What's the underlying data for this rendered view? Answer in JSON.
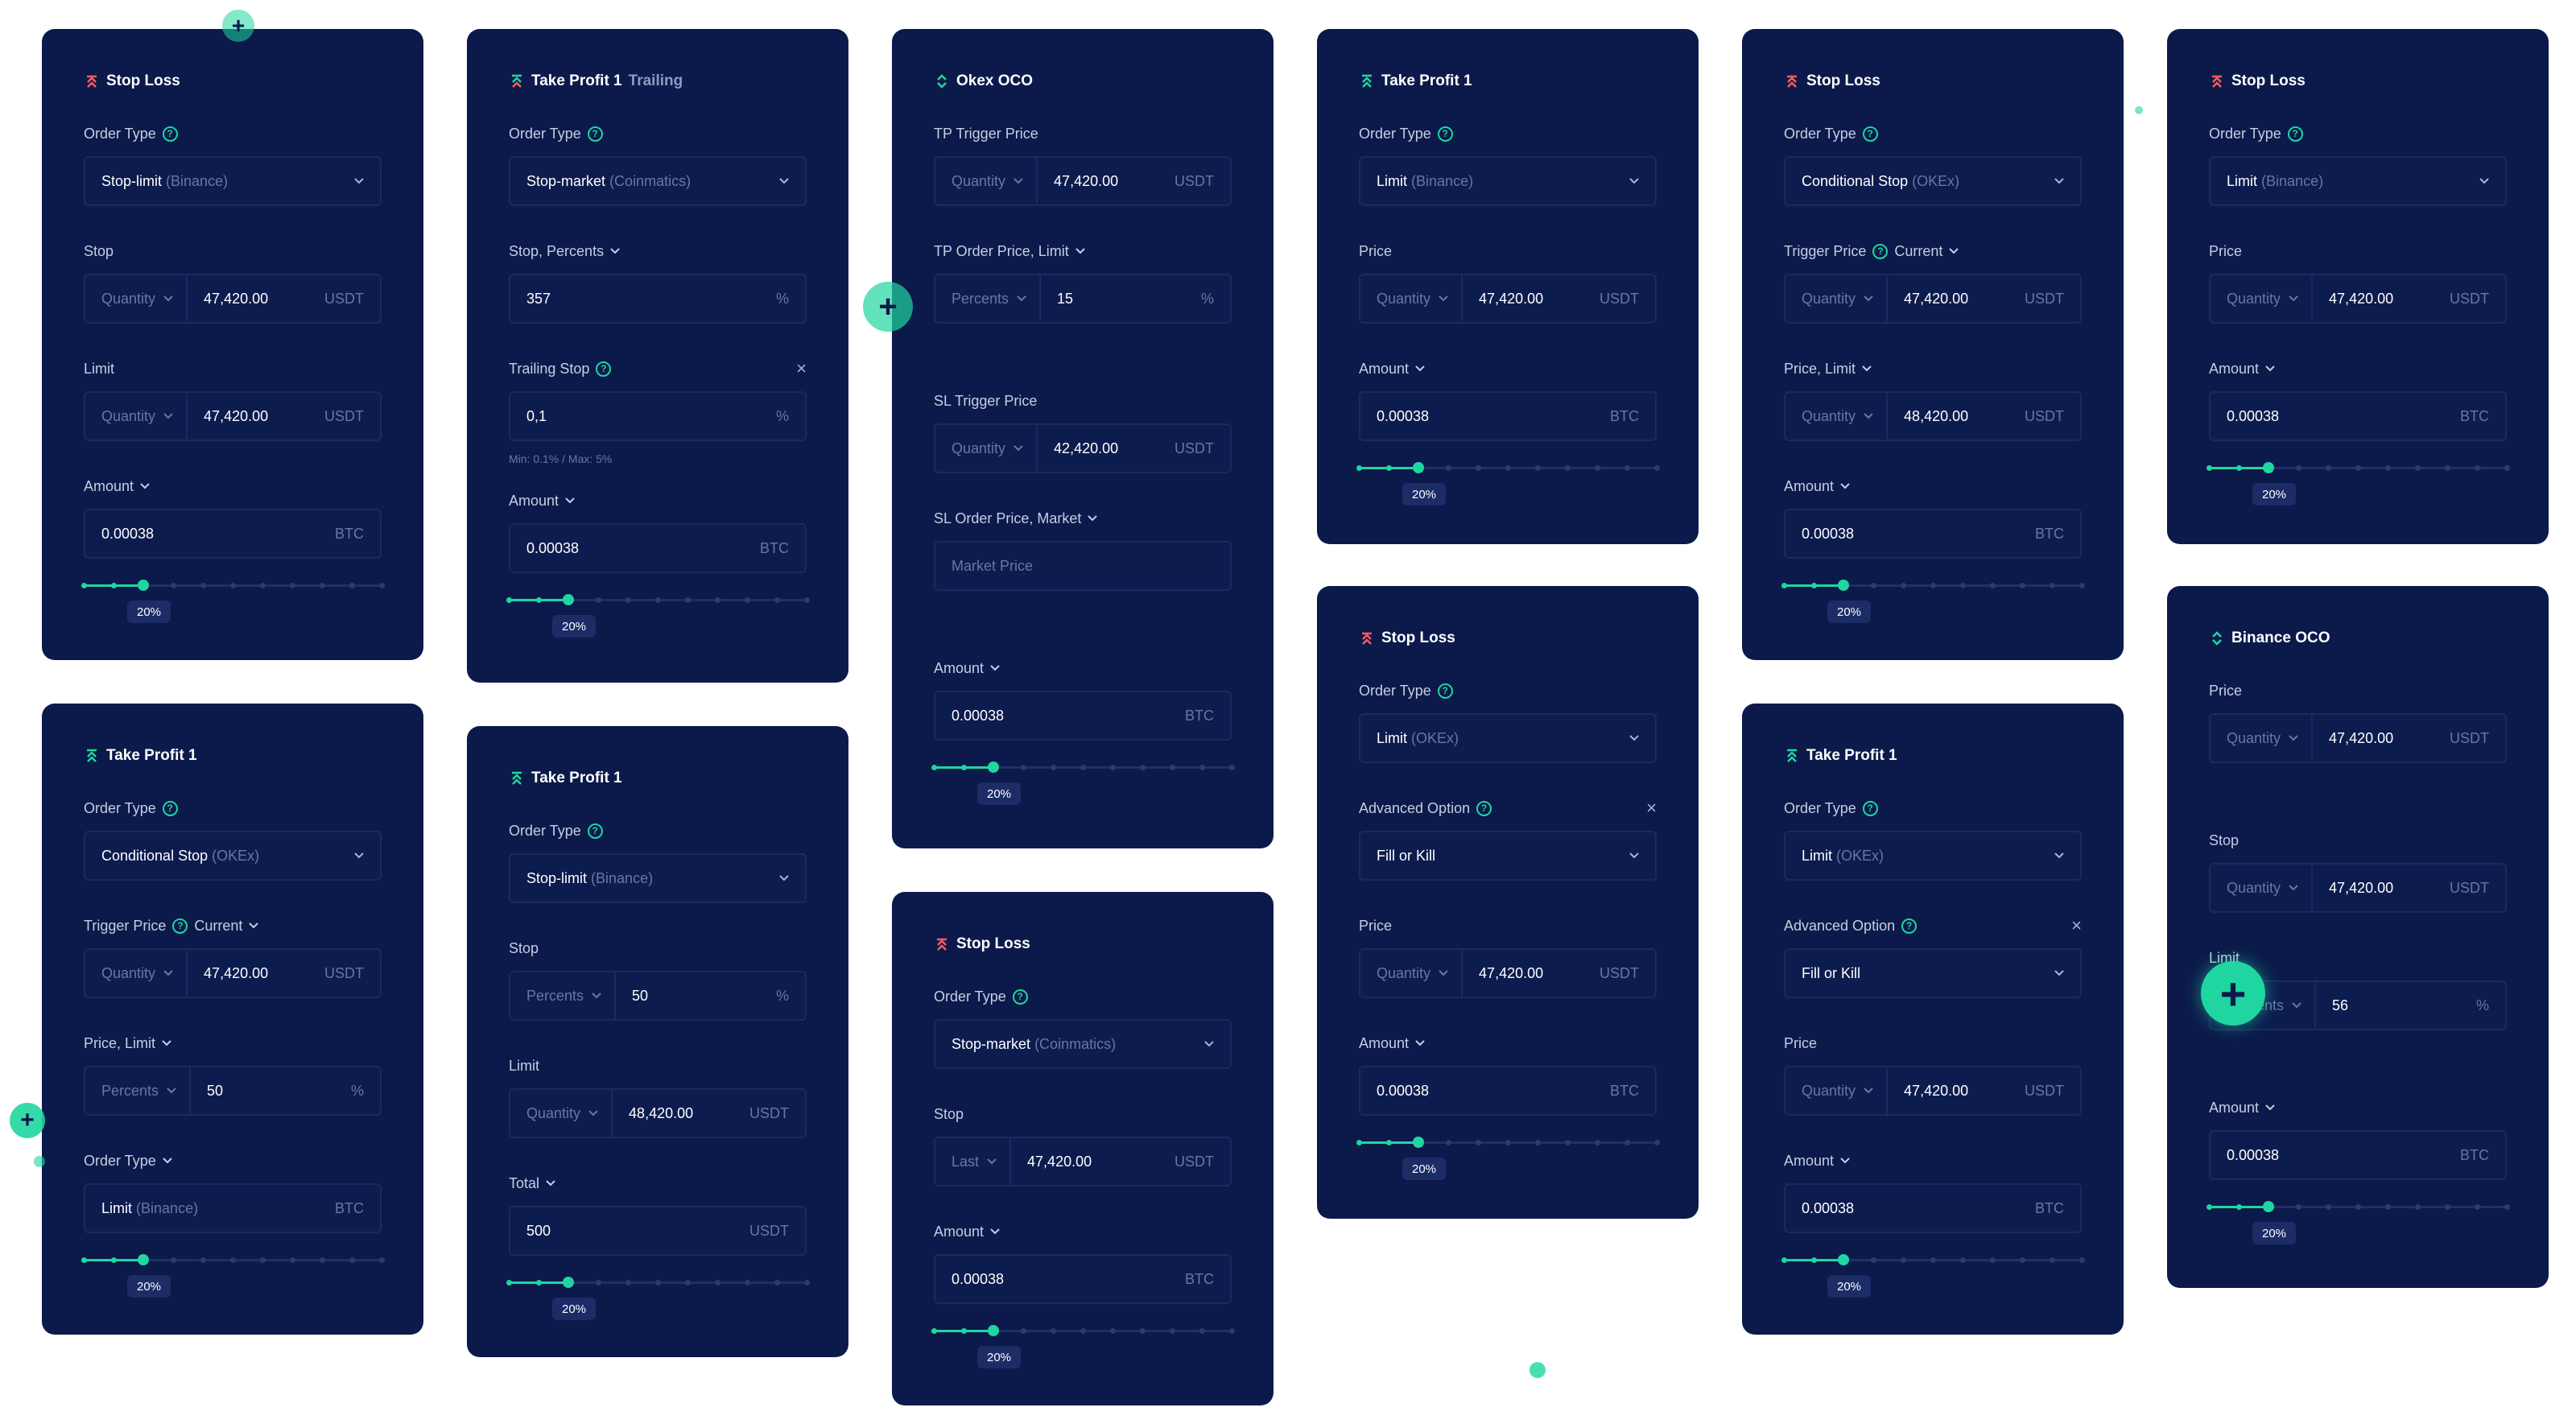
{
  "labels": {
    "order_type": "Order Type",
    "stop": "Stop",
    "limit": "Limit",
    "amount": "Amount",
    "price": "Price",
    "quantity": "Quantity",
    "percents": "Percents",
    "last": "Last",
    "usdt": "USDT",
    "btc": "BTC",
    "pct": "%",
    "current": "Current",
    "trigger_price": "Trigger Price",
    "price_limit": "Price, Limit",
    "advanced_option": "Advanced Option",
    "trailing_stop": "Trailing Stop",
    "stop_percents": "Stop, Percents",
    "total": "Total",
    "tp_trigger_price": "TP Trigger Price",
    "tp_order_price_limit": "TP Order Price, Limit",
    "sl_trigger_price": "SL Trigger Price",
    "sl_order_price_market": "SL Order Price, Market",
    "market_price": "Market Price",
    "fill_or_kill": "Fill or Kill",
    "trailing_hint": "Min: 0.1% / Max: 5%",
    "slider_badge": "20%"
  },
  "titles": {
    "stop_loss": "Stop Loss",
    "take_profit_1": "Take Profit 1",
    "trailing": "Trailing",
    "okex_oco": "Okex OCO",
    "binance_oco": "Binance OCO"
  },
  "values": {
    "qty_47420": "47,420.00",
    "qty_48420": "48,420.00",
    "qty_42420": "42,420.00",
    "amount": "0.00038",
    "stop_pct": "357",
    "trailing": "0,1",
    "tp_pct": "15",
    "pct_50": "50",
    "pct_56": "56",
    "total": "500",
    "slider_level": 0.2
  },
  "order_types": {
    "stop_limit": "Stop-limit",
    "stop_market": "Stop-market",
    "limit": "Limit",
    "conditional_stop": "Conditional Stop",
    "binance": "(Binance)",
    "coinmatics": "(Coinmatics)",
    "okex": "(OKEx)"
  },
  "colors": {
    "card_bg": "#0b1a4a",
    "accent_green": "#1fd6a0",
    "stop_loss_red": "#ff5c5c",
    "field_border": "#1a2a5e"
  }
}
